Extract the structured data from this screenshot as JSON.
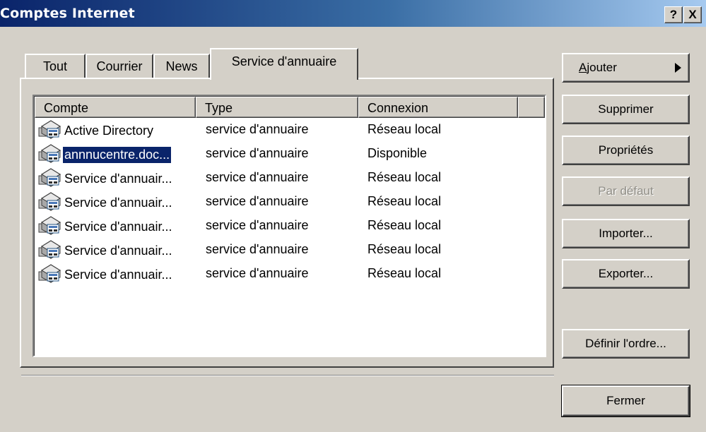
{
  "window": {
    "title": "Comptes Internet",
    "help_label": "?",
    "close_label": "X"
  },
  "tabs": [
    {
      "label": "Tout"
    },
    {
      "label": "Courrier"
    },
    {
      "label": "News"
    },
    {
      "label": "Service d'annuaire",
      "active": true
    }
  ],
  "list": {
    "columns": [
      "Compte",
      "Type",
      "Connexion",
      ""
    ],
    "rows": [
      {
        "account": "Active Directory",
        "type": "service d'annuaire",
        "connection": "Réseau local",
        "selected": false,
        "icon": "directory-service-icon"
      },
      {
        "account": "annnucentre.doc...",
        "type": "service d'annuaire",
        "connection": "Disponible",
        "selected": true,
        "icon": "directory-service-icon"
      },
      {
        "account": "Service d'annuair...",
        "type": "service d'annuaire",
        "connection": "Réseau local",
        "selected": false,
        "icon": "directory-service-icon"
      },
      {
        "account": "Service d'annuair...",
        "type": "service d'annuaire",
        "connection": "Réseau local",
        "selected": false,
        "icon": "directory-service-icon"
      },
      {
        "account": "Service d'annuair...",
        "type": "service d'annuaire",
        "connection": "Réseau local",
        "selected": false,
        "icon": "directory-service-icon"
      },
      {
        "account": "Service d'annuair...",
        "type": "service d'annuaire",
        "connection": "Réseau local",
        "selected": false,
        "icon": "directory-service-icon"
      },
      {
        "account": "Service d'annuair...",
        "type": "service d'annuaire",
        "connection": "Réseau local",
        "selected": false,
        "icon": "directory-service-icon"
      }
    ]
  },
  "buttons": {
    "add_mnemonic": "A",
    "add_rest": "jouter",
    "delete": "Supprimer",
    "properties": "Propriétés",
    "set_default": "Par défaut",
    "import": "Importer...",
    "export": "Exporter...",
    "set_order": "Définir l'ordre...",
    "close": "Fermer"
  },
  "colors": {
    "selection": "#0a246a",
    "face": "#d4d0c8"
  }
}
